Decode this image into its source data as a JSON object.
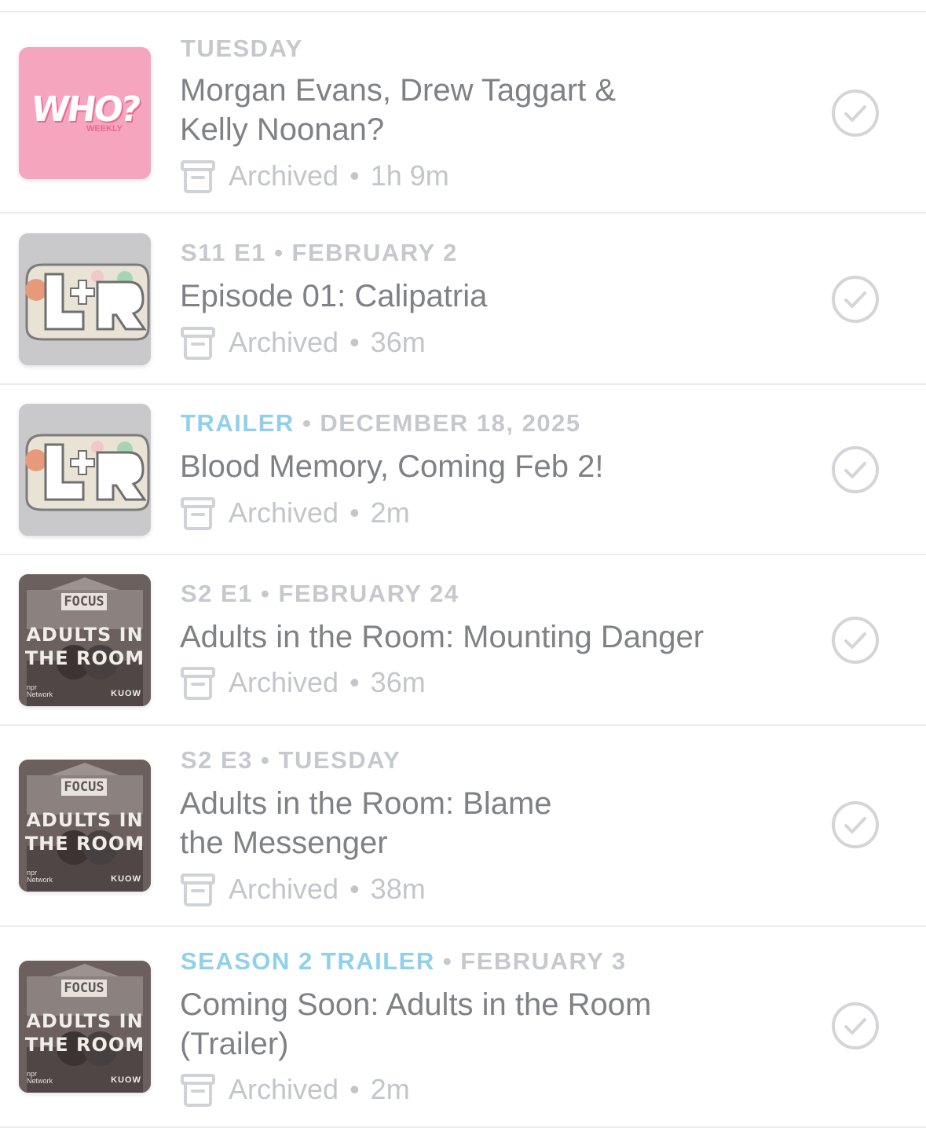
{
  "episodes": [
    {
      "artwork": {
        "name": "who-weekly",
        "text_main": "WHO?",
        "text_sub": "WEEKLY"
      },
      "meta_accent": "",
      "meta": "TUESDAY",
      "title_line1": "Morgan Evans, Drew Taggart &",
      "title_line2": "Kelly Noonan?",
      "status": "Archived",
      "duration": "1h 9m"
    },
    {
      "artwork": {
        "name": "lr-podcast"
      },
      "meta_accent": "",
      "meta": "S11 E1 • FEBRUARY 2",
      "title_line1": "Episode 01: Calipatria",
      "title_line2": "",
      "status": "Archived",
      "duration": "36m"
    },
    {
      "artwork": {
        "name": "lr-podcast"
      },
      "meta_accent": "TRAILER",
      "meta": " • DECEMBER 18, 2025",
      "title_line1": "Blood Memory, Coming Feb 2!",
      "title_line2": "",
      "status": "Archived",
      "duration": "2m"
    },
    {
      "artwork": {
        "name": "adults-in-the-room",
        "focus": "FOCUS",
        "line1": "ADULTS IN",
        "line2": "THE ROOM",
        "npr": "npr",
        "npr_sub": "Network",
        "kuow": "KUOW"
      },
      "meta_accent": "",
      "meta": "S2 E1 • FEBRUARY 24",
      "title_line1": "Adults in the Room: Mounting Danger",
      "title_line2": "",
      "status": "Archived",
      "duration": "36m"
    },
    {
      "artwork": {
        "name": "adults-in-the-room",
        "focus": "FOCUS",
        "line1": "ADULTS IN",
        "line2": "THE ROOM",
        "npr": "npr",
        "npr_sub": "Network",
        "kuow": "KUOW"
      },
      "meta_accent": "",
      "meta": "S2 E3 • TUESDAY",
      "title_line1": "Adults in the Room: Blame",
      "title_line2": "the Messenger",
      "status": "Archived",
      "duration": "38m"
    },
    {
      "artwork": {
        "name": "adults-in-the-room",
        "focus": "FOCUS",
        "line1": "ADULTS IN",
        "line2": "THE ROOM",
        "npr": "npr",
        "npr_sub": "Network",
        "kuow": "KUOW"
      },
      "meta_accent": "SEASON 2 TRAILER",
      "meta": " • FEBRUARY 3",
      "title_line1": "Coming Soon: Adults in the Room",
      "title_line2": "(Trailer)",
      "status": "Archived",
      "duration": "2m"
    }
  ],
  "separator": "•",
  "colors": {
    "accent": "#8fd0ec",
    "meta": "#c5c8cd",
    "title": "#7f8185",
    "status": "#c2c5ca",
    "check": "#d4d5d8"
  }
}
